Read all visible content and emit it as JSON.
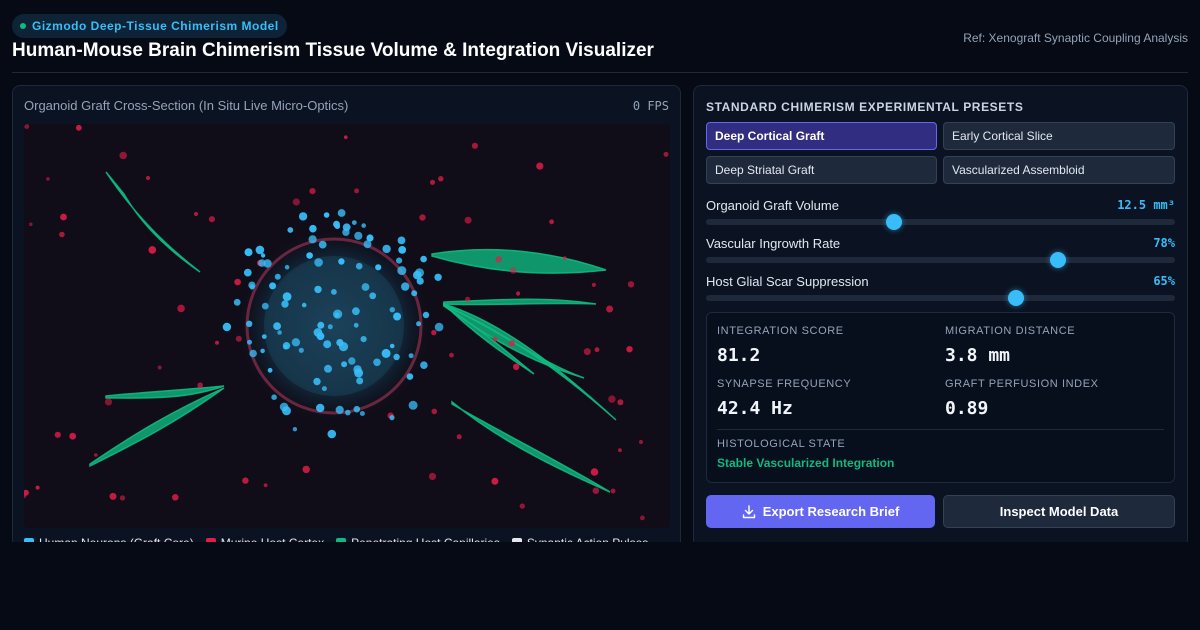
{
  "header": {
    "badge": "Gizmodo Deep-Tissue Chimerism Model",
    "title": "Human-Mouse Brain Chimerism Tissue Volume & Integration Visualizer",
    "ref": "Ref: Xenograft Synaptic Coupling Analysis"
  },
  "viewer": {
    "title": "Organoid Graft Cross-Section (In Situ Live Micro-Optics)",
    "fps": "0 FPS",
    "legend": [
      {
        "label": "Human Neurons (Graft Core)",
        "color": "#38bdf8"
      },
      {
        "label": "Murine Host Cortex",
        "color": "#e11d48"
      },
      {
        "label": "Penetrating Host Capillaries",
        "color": "#10b981"
      },
      {
        "label": "Synaptic Action Pulses",
        "color": "#e2e8f0"
      }
    ]
  },
  "controls": {
    "presets_title": "STANDARD CHIMERISM EXPERIMENTAL PRESETS",
    "presets": [
      {
        "label": "Deep Cortical Graft",
        "active": true
      },
      {
        "label": "Early Cortical Slice",
        "active": false
      },
      {
        "label": "Deep Striatal Graft",
        "active": false
      },
      {
        "label": "Vascularized Assembloid",
        "active": false
      }
    ],
    "sliders": [
      {
        "label": "Organoid Graft Volume",
        "value": "12.5 mm³",
        "level": 0.4
      },
      {
        "label": "Vascular Ingrowth Rate",
        "value": "78%",
        "level": 0.75
      },
      {
        "label": "Host Glial Scar Suppression",
        "value": "65%",
        "level": 0.66
      }
    ]
  },
  "stats": {
    "integration_label": "INTEGRATION SCORE",
    "integration_value": "81.2",
    "migration_label": "MIGRATION DISTANCE",
    "migration_value": "3.8 mm",
    "synapse_label": "SYNAPSE FREQUENCY",
    "synapse_value": "42.4 Hz",
    "perfusion_label": "GRAFT PERFUSION INDEX",
    "perfusion_value": "0.89",
    "histology_label": "HISTOLOGICAL STATE",
    "histology_value": "Stable Vascularized Integration"
  },
  "actions": {
    "export_label": "Export Research Brief",
    "inspect_label": "Inspect Model Data"
  },
  "colors": {
    "accent": "#6366f1",
    "neuron": "#38bdf8",
    "host": "#e11d48",
    "capillary": "#10b981"
  }
}
